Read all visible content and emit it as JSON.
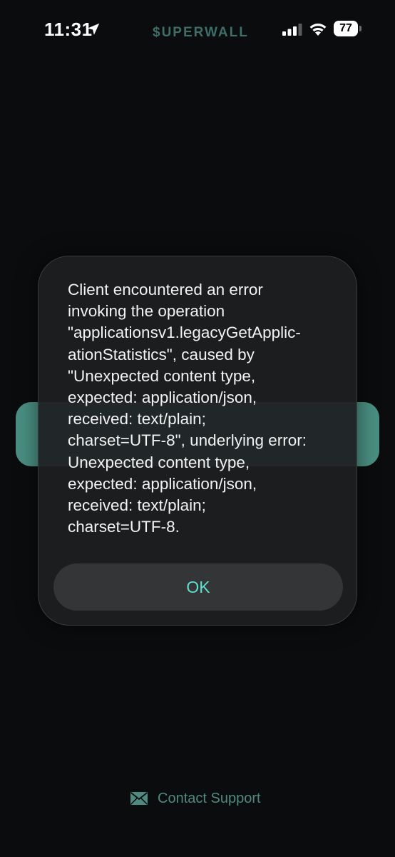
{
  "status_bar": {
    "time": "11:31",
    "brand": "$UPERWALL",
    "battery_level": "77",
    "icons": [
      "location-arrow-icon",
      "cellular-signal-icon",
      "wifi-icon",
      "battery-icon"
    ]
  },
  "alert": {
    "message": "Client encountered an error\ninvoking the operation\n\"applicationsv1.legacyGetApplic-\nationStatistics\", caused by\n\"Unexpected content type,\nexpected: application/json,\nreceived: text/plain;\ncharset=UTF-8\", underlying error:\nUnexpected content type,\nexpected: application/json,\nreceived: text/plain;\ncharset=UTF-8.",
    "ok_label": "OK"
  },
  "footer": {
    "contact_label": "Contact Support",
    "icon": "mail-icon"
  },
  "colors": {
    "background": "#0b0c0d",
    "accent": "#5ee0cf",
    "brand": "#3f6e68",
    "bg_pill": "#4a8f82",
    "contact": "#4f8a80"
  }
}
